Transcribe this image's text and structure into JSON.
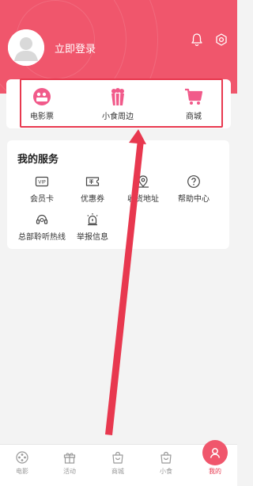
{
  "header": {
    "login_text": "立即登录",
    "bell_icon": "bell-icon",
    "settings_icon": "settings-hexagon-icon",
    "accent_color": "#f0566c"
  },
  "quick_links": [
    {
      "label": "电影票",
      "icon": "film-ticket-icon"
    },
    {
      "label": "小食周边",
      "icon": "popcorn-icon"
    },
    {
      "label": "商城",
      "icon": "shopping-cart-icon"
    }
  ],
  "services": {
    "title": "我的服务",
    "items": [
      {
        "label": "会员卡",
        "icon": "vip-card-icon"
      },
      {
        "label": "优惠券",
        "icon": "coupon-icon"
      },
      {
        "label": "收货地址",
        "icon": "location-pin-icon"
      },
      {
        "label": "帮助中心",
        "icon": "help-icon"
      },
      {
        "label": "总部聆听热线",
        "icon": "headset-icon"
      },
      {
        "label": "举报信息",
        "icon": "alarm-icon"
      }
    ]
  },
  "tabbar": {
    "items": [
      {
        "label": "电影",
        "icon": "film-reel-icon",
        "active": false
      },
      {
        "label": "活动",
        "icon": "gift-icon",
        "active": false
      },
      {
        "label": "商城",
        "icon": "bag-icon",
        "active": false
      },
      {
        "label": "小食",
        "icon": "bag-icon",
        "active": false
      },
      {
        "label": "我的",
        "icon": "user-icon",
        "active": true
      }
    ],
    "active_color": "#e8384f"
  },
  "annotation": {
    "highlight_color": "#e8384f"
  }
}
